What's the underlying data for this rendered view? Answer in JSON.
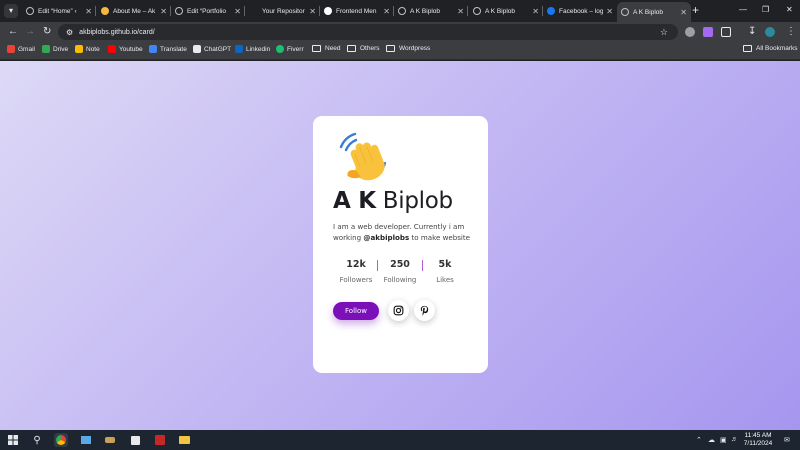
{
  "browser": {
    "tabs": [
      {
        "title": "Edit “Home” ‹",
        "favicon": "wordpress-icon"
      },
      {
        "title": "About Me – Ak",
        "favicon": "amazon-icon"
      },
      {
        "title": "Edit “Portfolio",
        "favicon": "wordpress-icon"
      },
      {
        "title": "Your Repositor",
        "favicon": "github-icon"
      },
      {
        "title": "Frontend Men",
        "favicon": "frontend-mentor-icon"
      },
      {
        "title": "A K Biplob",
        "favicon": "globe-icon"
      },
      {
        "title": "A K Biplob",
        "favicon": "globe-icon"
      },
      {
        "title": "Facebook – log",
        "favicon": "facebook-icon"
      },
      {
        "title": "A K Biplob",
        "favicon": "globe-icon",
        "active": true
      }
    ],
    "url": "akbiplobs.github.io/card/",
    "bookmarks": [
      {
        "label": "Gmail",
        "icon": "gmail-icon"
      },
      {
        "label": "Drive",
        "icon": "drive-icon"
      },
      {
        "label": "Note",
        "icon": "note-icon"
      },
      {
        "label": "Youtube",
        "icon": "youtube-icon"
      },
      {
        "label": "Translate",
        "icon": "translate-icon"
      },
      {
        "label": "ChatGPT",
        "icon": "chatgpt-icon"
      },
      {
        "label": "Linkedin",
        "icon": "linkedin-icon"
      },
      {
        "label": "Fiverr",
        "icon": "fiverr-icon"
      },
      {
        "label": "Need",
        "icon": "folder-icon"
      },
      {
        "label": "Others",
        "icon": "folder-icon"
      },
      {
        "label": "Wordpress",
        "icon": "folder-icon"
      }
    ],
    "all_bookmarks": "All Bookmarks"
  },
  "card": {
    "emoji": "waving-hand-icon",
    "first_name": "A K",
    "last_name": "Biplob",
    "bio_lead": "I am a web developer. Currently i am working ",
    "bio_handle": "@akbiplobs",
    "bio_tail": " to make website",
    "stats": [
      {
        "value": "12k",
        "label": "Followers"
      },
      {
        "value": "250",
        "label": "Following"
      },
      {
        "value": "5k",
        "label": "Likes"
      }
    ],
    "follow_label": "Follow",
    "socials": [
      "instagram-icon",
      "pinterest-icon"
    ]
  },
  "taskbar": {
    "time": "11:45 AM",
    "date": "7/11/2024"
  },
  "colors": {
    "accent": "#7b10b8",
    "stat_divider": "#b05bd8",
    "bg_start": "#ddd9f6",
    "bg_end": "#a696ef"
  }
}
